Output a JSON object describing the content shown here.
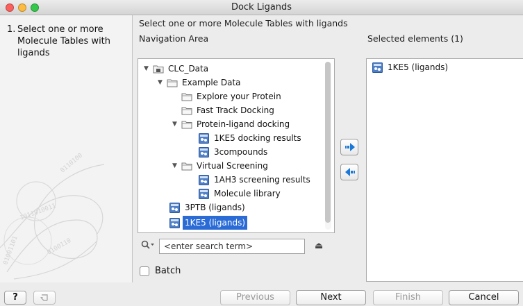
{
  "window": {
    "title": "Dock Ligands"
  },
  "steps": [
    {
      "number": "1.",
      "label": "Select one or more Molecule Tables with ligands"
    }
  ],
  "main": {
    "instruction": "Select one or more Molecule Tables with ligands",
    "navigation_heading": "Navigation Area",
    "selected_heading": "Selected elements (1)"
  },
  "tree": [
    {
      "label": "CLC_Data",
      "icon": "database-folder-icon",
      "expanded": true,
      "selected": false
    },
    {
      "label": "Example Data",
      "icon": "folder-icon",
      "expanded": true,
      "selected": false
    },
    {
      "label": "Explore your Protein",
      "icon": "folder-icon",
      "selected": false
    },
    {
      "label": "Fast Track Docking",
      "icon": "folder-icon",
      "selected": false
    },
    {
      "label": "Protein-ligand docking",
      "icon": "folder-icon",
      "expanded": true,
      "selected": false
    },
    {
      "label": "1KE5 docking results",
      "icon": "molecule-table-icon",
      "selected": false
    },
    {
      "label": "3compounds",
      "icon": "molecule-table-icon",
      "selected": false
    },
    {
      "label": "Virtual Screening",
      "icon": "folder-icon",
      "expanded": true,
      "selected": false
    },
    {
      "label": "1AH3 screening results",
      "icon": "molecule-table-icon",
      "selected": false
    },
    {
      "label": "Molecule library",
      "icon": "molecule-table-icon",
      "selected": false
    },
    {
      "label": "3PTB (ligands)",
      "icon": "molecule-table-icon",
      "selected": false
    },
    {
      "label": "1KE5 (ligands)",
      "icon": "molecule-table-icon",
      "selected": true
    }
  ],
  "search": {
    "placeholder": "<enter search term>",
    "value": ""
  },
  "batch": {
    "label": "Batch",
    "checked": false
  },
  "selected_elements": [
    {
      "label": "1KE5 (ligands)",
      "icon": "molecule-table-icon"
    }
  ],
  "buttons": {
    "help": "?",
    "previous": "Previous",
    "next": "Next",
    "finish": "Finish",
    "cancel": "Cancel"
  },
  "colors": {
    "selection": "#2a6bd6",
    "arrow": "#1a78d8"
  }
}
